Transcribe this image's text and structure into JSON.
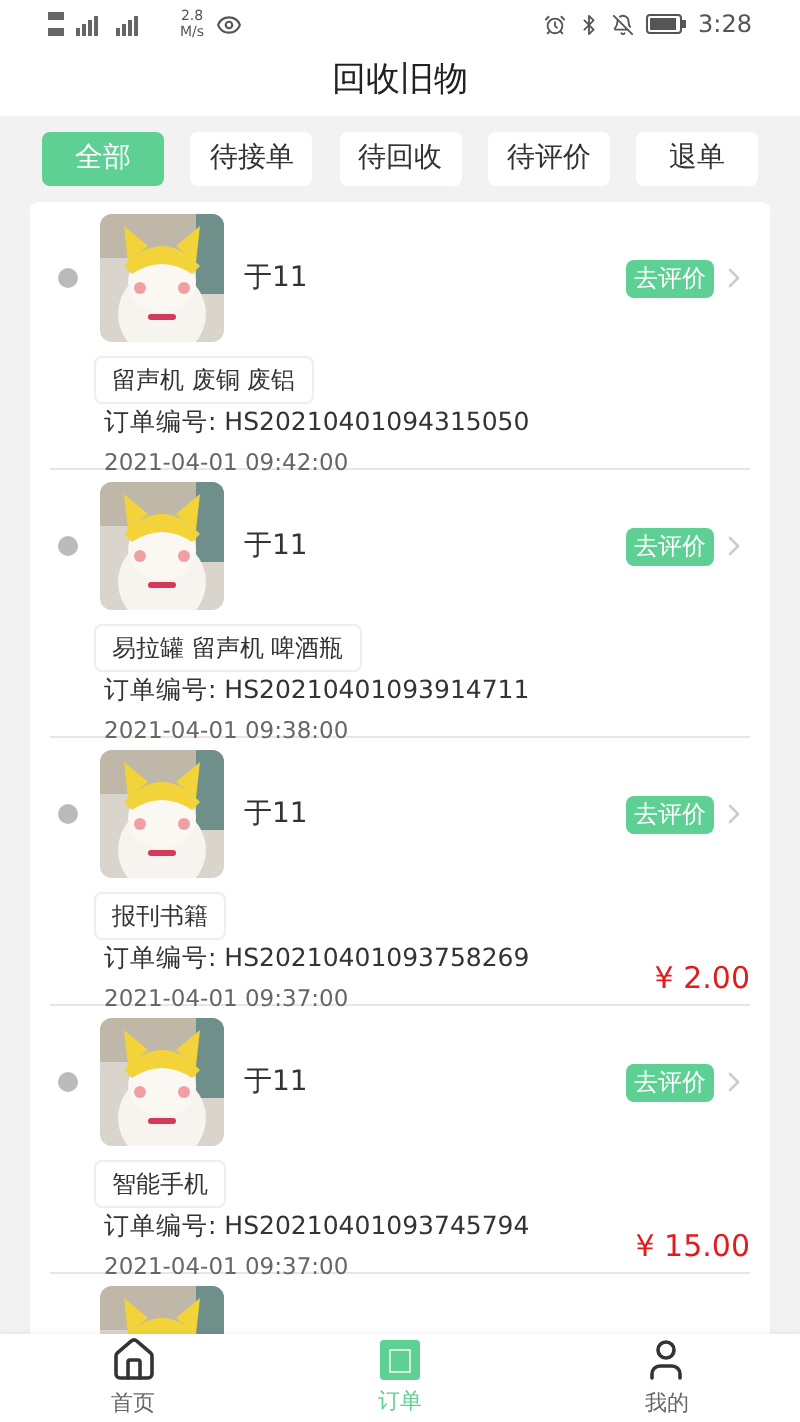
{
  "status_bar": {
    "speed": "2.8",
    "speed_unit": "M/s",
    "time": "3:28"
  },
  "title": "回收旧物",
  "filters": [
    {
      "label": "全部",
      "selected": true
    },
    {
      "label": "待接单",
      "selected": false
    },
    {
      "label": "待回收",
      "selected": false
    },
    {
      "label": "待评价",
      "selected": false
    },
    {
      "label": "退单",
      "selected": false
    }
  ],
  "orders": [
    {
      "name": "于11",
      "action": "去评价",
      "items": "留声机 废铜 废铝",
      "order_no": "订单编号: HS20210401094315050",
      "date": "2021-04-01 09:42:00"
    },
    {
      "name": "于11",
      "action": "去评价",
      "items": "易拉罐 留声机 啤酒瓶",
      "order_no": "订单编号: HS20210401093914711",
      "date": "2021-04-01 09:38:00"
    },
    {
      "name": "于11",
      "action": "去评价",
      "items": "报刊书籍",
      "order_no": "订单编号: HS20210401093758269",
      "date": "2021-04-01 09:37:00",
      "price": "¥ 2.00"
    },
    {
      "name": "于11",
      "action": "去评价",
      "items": "智能手机",
      "order_no": "订单编号: HS20210401093745794",
      "date": "2021-04-01 09:37:00",
      "price": "¥ 15.00"
    }
  ],
  "tab_bar": [
    {
      "kind": "home",
      "label": "首页",
      "selected": false
    },
    {
      "kind": "orders",
      "label": "订单",
      "selected": true
    },
    {
      "kind": "profile",
      "label": "我的",
      "selected": false
    }
  ]
}
